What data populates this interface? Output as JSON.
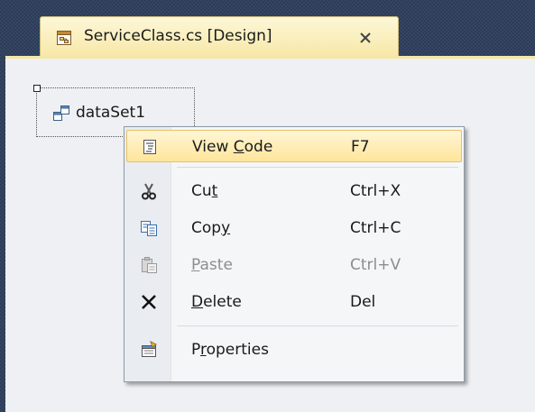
{
  "document_tab": {
    "title": "ServiceClass.cs [Design]",
    "icon": "designer-form-icon",
    "close_icon": "close-icon"
  },
  "component_tray": {
    "items": [
      {
        "label": "dataSet1",
        "icon": "dataset-icon",
        "selected": true
      }
    ]
  },
  "context_menu": {
    "items": [
      {
        "label": "View Code",
        "mnemonic": "C",
        "shortcut": "F7",
        "icon": "view-code-icon",
        "highlighted": true,
        "enabled": true
      },
      {
        "label": "Cut",
        "mnemonic": "t",
        "shortcut": "Ctrl+X",
        "icon": "scissors-icon",
        "highlighted": false,
        "enabled": true
      },
      {
        "label": "Copy",
        "mnemonic": "y",
        "shortcut": "Ctrl+C",
        "icon": "copy-icon",
        "highlighted": false,
        "enabled": true
      },
      {
        "label": "Paste",
        "mnemonic": "P",
        "shortcut": "Ctrl+V",
        "icon": "paste-icon",
        "highlighted": false,
        "enabled": false
      },
      {
        "label": "Delete",
        "mnemonic": "D",
        "shortcut": "Del",
        "icon": "delete-x-icon",
        "highlighted": false,
        "enabled": true
      },
      {
        "label": "Properties",
        "mnemonic": "r",
        "shortcut": "",
        "icon": "properties-icon",
        "highlighted": false,
        "enabled": true
      }
    ]
  },
  "colors": {
    "chrome_background": "#2b3c59",
    "tab_active": "#f7e8a8",
    "designer_surface": "#eef0f3",
    "menu_highlight": "#ffe59a",
    "disabled_text": "#8d8d8d"
  }
}
